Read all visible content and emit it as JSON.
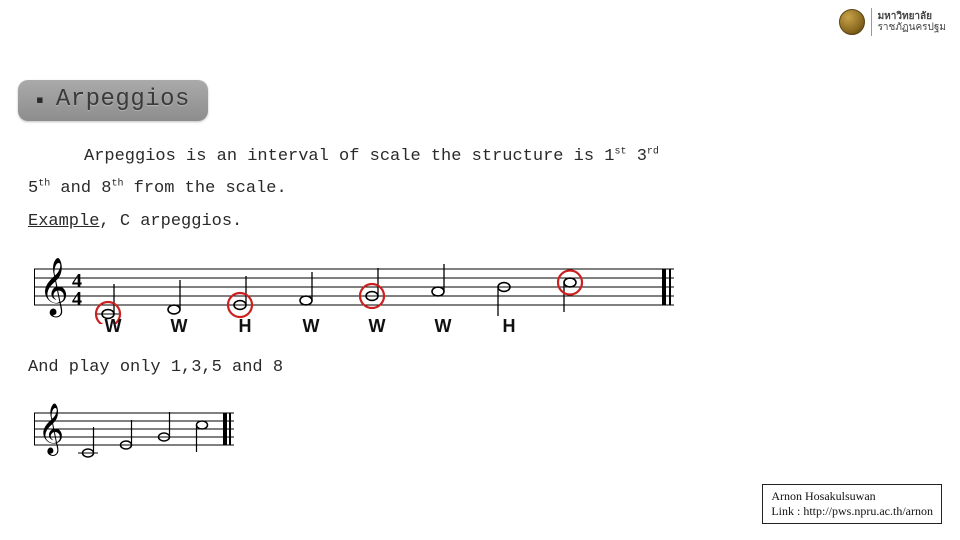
{
  "logo": {
    "line1": "มหาวิทยาลัย",
    "line2": "ราชภัฏนครปฐม"
  },
  "section": {
    "bullet": "▪",
    "title": "Arpeggios"
  },
  "paragraph": {
    "line1_a": "Arpeggios is an interval of scale the structure is 1",
    "sup1": "st",
    "line1_b": " 3",
    "sup2": "rd",
    "line2_a": "5",
    "sup3": "th",
    "line2_b": " and 8",
    "sup4": "th",
    "line2_c": " from the scale.",
    "example_label": "Example",
    "example_rest": ", C arpeggios."
  },
  "staff1": {
    "intervals": [
      "W",
      "W",
      "H",
      "W",
      "W",
      "W",
      "H"
    ],
    "circled_degrees": [
      1,
      3,
      5,
      8
    ],
    "notes_count": 8
  },
  "play_line": "And play only 1,3,5 and 8",
  "staff2": {
    "notes_count": 4
  },
  "credit": {
    "name": "Arnon Hosakulsuwan",
    "link_label": "Link : http://pws.npru.ac.th/arnon"
  }
}
